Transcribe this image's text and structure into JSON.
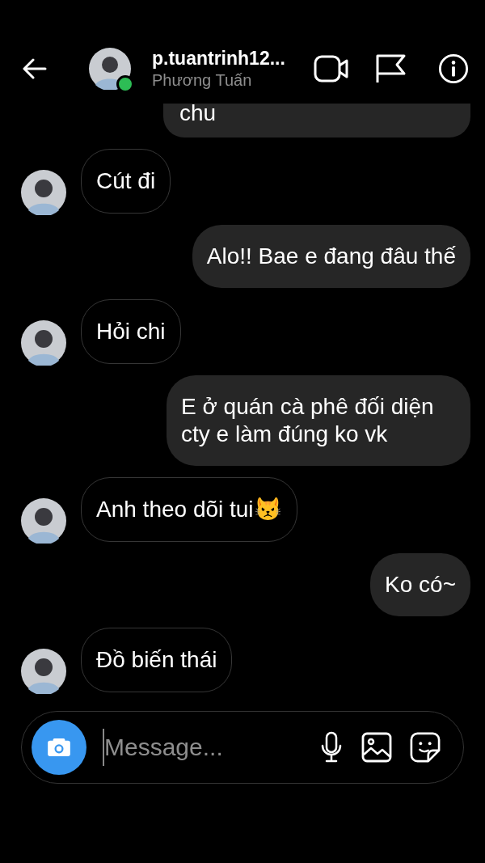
{
  "header": {
    "username": "p.tuantrinh12...",
    "display_name": "Phương Tuấn",
    "online": true
  },
  "messages": [
    {
      "kind": "sent",
      "text": "chu"
    },
    {
      "kind": "received",
      "text": "Cút đi"
    },
    {
      "kind": "sent",
      "text": "Alo!! Bae e đang đâu thế"
    },
    {
      "kind": "received",
      "text": "Hỏi chi"
    },
    {
      "kind": "sent",
      "text": "E ở quán cà phê đối diện cty e làm đúng ko vk"
    },
    {
      "kind": "received",
      "text": "Anh theo dõi tui😾"
    },
    {
      "kind": "sent",
      "text": "Ko có~"
    },
    {
      "kind": "received",
      "text": "Đồ biến thái"
    }
  ],
  "composer": {
    "placeholder": "Message..."
  }
}
